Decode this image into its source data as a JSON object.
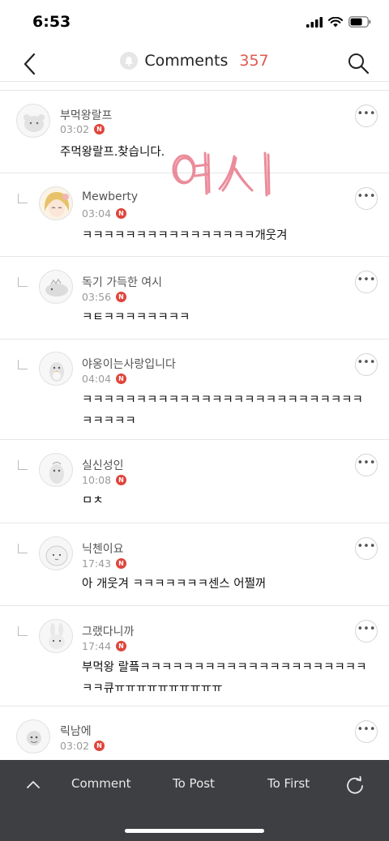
{
  "status_bar": {
    "time": "6:53"
  },
  "nav": {
    "title": "Comments",
    "count": "357"
  },
  "comments": [
    {
      "author": "부먹왕랄프",
      "time": "03:02",
      "new_badge": "N",
      "text": "주먹왕랄프.찾습니다.",
      "is_reply": false
    },
    {
      "author": "Mewberty",
      "time": "03:04",
      "new_badge": "N",
      "text": "ㅋㅋㅋㅋㅋㅋㅋㅋㅋㅋㅋㅋㅋㅋㅋㅋ개웃겨",
      "is_reply": true
    },
    {
      "author": "독기 가득한 여시",
      "time": "03:56",
      "new_badge": "N",
      "text": "ㅋㅌㅋㅋㅋㅋㅋㅋㅋㅋ",
      "is_reply": true
    },
    {
      "author": "야옹이는사랑입니다",
      "time": "04:04",
      "new_badge": "N",
      "text": "ㅋㅋㅋㅋㅋㅋㅋㅋㅋㅋㅋㅋㅋㅋㅋㅋㅋㅋㅋㅋㅋㅋㅋㅋㅋㅋㅋㅋㅋㅋㅋ",
      "is_reply": true
    },
    {
      "author": "실신성인",
      "time": "10:08",
      "new_badge": "N",
      "text": "ㅁㅊ",
      "is_reply": true
    },
    {
      "author": "닉첸이요",
      "time": "17:43",
      "new_badge": "N",
      "text": "아 개웃겨 ㅋㅋㅋㅋㅋㅋㅋ센스 어쩔꺼",
      "is_reply": true
    },
    {
      "author": "그랬다니까",
      "time": "17:44",
      "new_badge": "N",
      "text": "부먹왕 랄픜ㅋㅋㅋㅋㅋㅋㅋㅋㅋㅋㅋㅋㅋㅋㅋㅋㅋㅋㅋㅋㅋㅋㅋ큐ㅠㅠㅠㅠㅠㅠㅠㅠㅠㅠ",
      "is_reply": true
    },
    {
      "author": "릭남에",
      "time": "03:02",
      "new_badge": "N",
      "text": "",
      "is_reply": false
    }
  ],
  "handwritten_overlay": "여시",
  "bottom_bar": {
    "comment_label": "Comment",
    "to_post_label": "To Post",
    "to_first_label": "To First"
  },
  "icons": {
    "back": "chevron-left-icon",
    "bell": "bell-icon",
    "search": "search-icon",
    "more": "more-icon",
    "up": "chevron-up-icon",
    "refresh": "refresh-icon"
  },
  "colors": {
    "accent": "#e05a4f",
    "badge": "#e0443b",
    "bottom_bar": "#3e3f42",
    "scribble": "#e8788a"
  }
}
